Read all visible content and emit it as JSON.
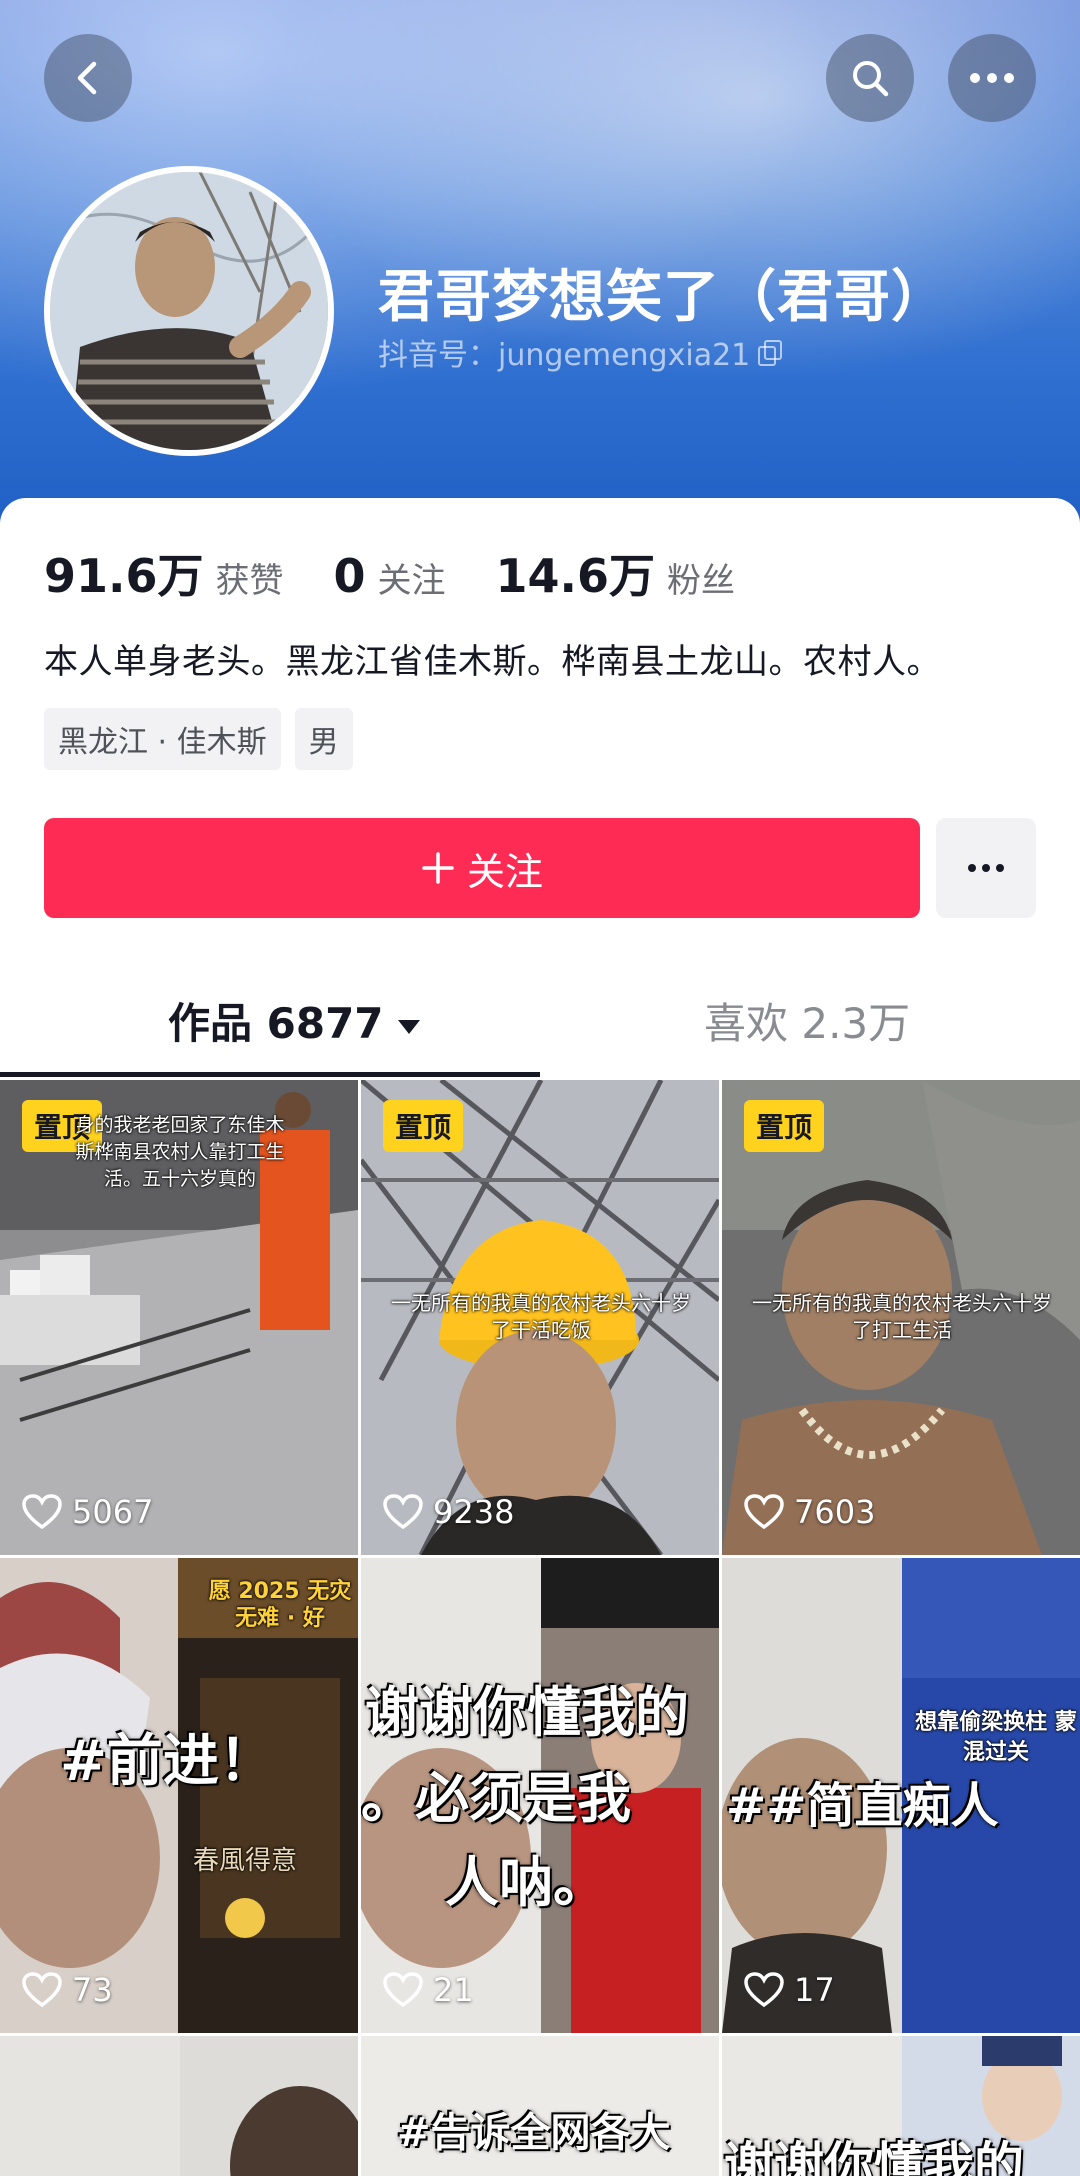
{
  "header": {
    "name": "君哥梦想笑了（君哥）",
    "douyin_id": "抖音号：jungemengxia21"
  },
  "stats": [
    {
      "value": "91.6万",
      "label": "获赞"
    },
    {
      "value": "0",
      "label": "关注"
    },
    {
      "value": "14.6万",
      "label": "粉丝"
    }
  ],
  "bio": "本人单身老头。黑龙江省佳木斯。桦南县土龙山。农村人。",
  "tags": [
    "黑龙江 · 佳木斯",
    "男"
  ],
  "actions": {
    "follow_label": "关注"
  },
  "tabs": {
    "works": "作品 6877",
    "likes": "喜欢 2.3万"
  },
  "videos": [
    {
      "pinned": "置顶",
      "caption": "身的我老老回家了东佳木斯桦南县农村人靠打工生活。五十六岁真的",
      "likes": "5067"
    },
    {
      "pinned": "置顶",
      "caption": "一无所有的我真的农村老头六十岁了干活吃饭",
      "likes": "9238"
    },
    {
      "pinned": "置顶",
      "caption": "一无所有的我真的农村老头六十岁了打工生活",
      "likes": "7603"
    },
    {
      "caption_big": "#前进！",
      "caption_small": "春風得意",
      "banner": "愿 2025 无灾无难 · 好",
      "likes": "73"
    },
    {
      "caption_big": "谢谢你懂我的",
      "caption_big2": "。必须是我",
      "caption_big3": "人呐。",
      "likes": "21"
    },
    {
      "caption_big": "##简直痴人",
      "banner": "想靠偷梁换柱 蒙混过关",
      "likes": "17"
    },
    {
      "caption_big": ""
    },
    {
      "caption_big": "#告诉全网各大"
    },
    {
      "caption_big": "谢谢你懂我的"
    }
  ],
  "colors": {
    "accent": "#fe2c55",
    "pin": "#ffd21e",
    "banner_blue": "#2f6fd0"
  }
}
